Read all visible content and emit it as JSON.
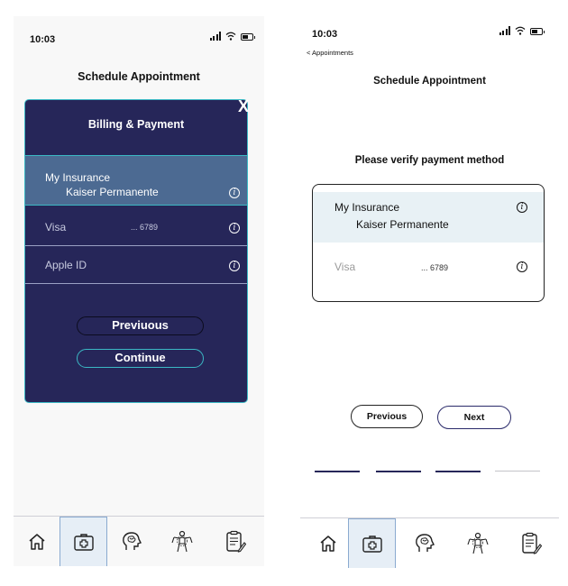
{
  "left_screen": {
    "status": {
      "time": "10:03"
    },
    "title": "Schedule Appointment",
    "modal": {
      "title": "Billing & Payment",
      "close_label": "X",
      "methods": [
        {
          "name": "My Insurance",
          "detail": "Kaiser Permanente",
          "selected": true
        },
        {
          "name": "Visa",
          "detail": "... 6789",
          "selected": false
        },
        {
          "name": "Apple ID",
          "detail": "",
          "selected": false
        }
      ],
      "info_glyph": "i",
      "previous_label": "Previuous",
      "continue_label": "Continue"
    },
    "tabs": [
      "home-icon",
      "medical-kit-icon",
      "brain-icon",
      "body-icon",
      "notes-icon"
    ],
    "active_tab": 1
  },
  "right_screen": {
    "status": {
      "time": "10:03"
    },
    "back_label": "< Appointments",
    "title": "Schedule Appointment",
    "prompt": "Please verify payment method",
    "methods": [
      {
        "name": "My Insurance",
        "detail": "Kaiser Permanente",
        "selected": true
      },
      {
        "name": "Visa",
        "detail": "... 6789",
        "selected": false
      }
    ],
    "info_glyph": "i",
    "previous_label": "Previous",
    "next_label": "Next",
    "progress": {
      "total_steps": 4,
      "completed_steps": 3
    },
    "tabs": [
      "home-icon",
      "medical-kit-icon",
      "brain-icon",
      "body-icon",
      "notes-icon"
    ],
    "active_tab": 1
  },
  "colors": {
    "modal_bg": "#262659",
    "accent": "#3bb8c4",
    "selected_row": "#4c6a92",
    "selected_row_light": "#e8f1f5"
  }
}
